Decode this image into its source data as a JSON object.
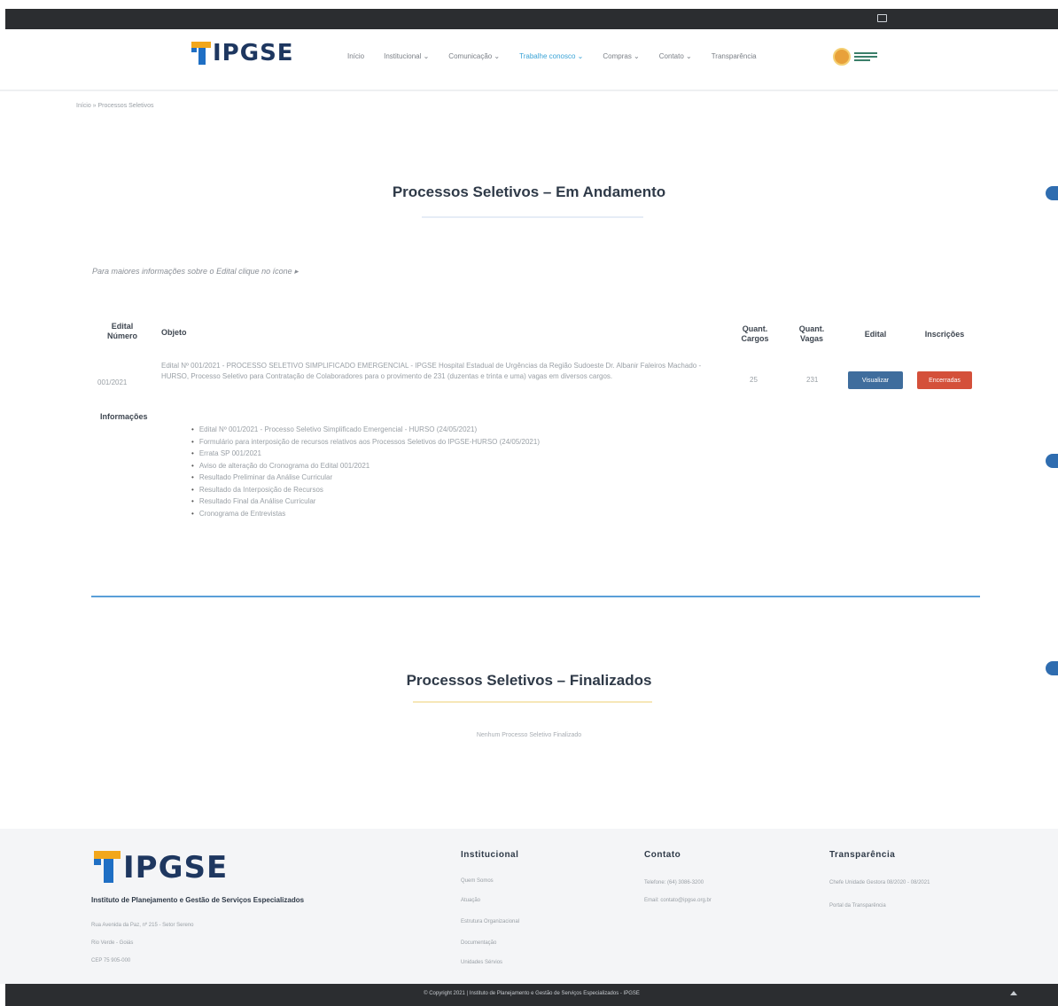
{
  "brand": {
    "name": "IPGSE",
    "tagline": "Instituto de Planejamento e Gestão de Serviços Especializados"
  },
  "nav": {
    "items": [
      "Início",
      "Institucional ⌄",
      "Comunicação ⌄",
      "Trabalhe conosco ⌄",
      "Compras ⌄",
      "Contato ⌄",
      "Transparência"
    ],
    "active_index": 3
  },
  "breadcrumb": "Início » Processos Seletivos",
  "andamento": {
    "title": "Processos Seletivos – Em Andamento",
    "info_line": "Para maiores informações sobre o Edital clique no ícone ▸",
    "table": {
      "headers": {
        "numero": "Edital Número",
        "objeto": "Objeto",
        "cargos": "Quant. Cargos",
        "vagas": "Quant. Vagas",
        "edital": "Edital",
        "inscricoes": "Inscrições"
      },
      "row": {
        "numero": "001/2021",
        "objeto": "Edital Nº 001/2021 - PROCESSO SELETIVO SIMPLIFICADO EMERGENCIAL - IPGSE Hospital Estadual de Urgências da Região Sudoeste Dr. Albanir Faleiros Machado - HURSO, Processo Seletivo para Contratação de Colaboradores para o provimento de 231 (duzentas e trinta e uma) vagas em diversos cargos.",
        "cargos": "25",
        "vagas": "231",
        "edital_button": "Visualizar",
        "inscricoes_button": "Encerradas"
      }
    },
    "info_label": "Informações",
    "info_items": [
      "Edital Nº 001/2021 - Processo Seletivo Simplificado Emergencial - HURSO (24/05/2021)",
      "Formulário para interposição de recursos relativos aos Processos Seletivos do IPGSE-HURSO (24/05/2021)",
      "Errata SP 001/2021",
      "Aviso de alteração do Cronograma do Edital 001/2021",
      "Resultado Preliminar da Análise Curricular",
      "Resultado da Interposição de Recursos",
      "Resultado Final da Análise Curricular",
      "Cronograma de Entrevistas"
    ]
  },
  "finalizados": {
    "title": "Processos Seletivos – Finalizados",
    "empty": "Nenhum Processo Seletivo Finalizado"
  },
  "footer": {
    "address": [
      "Rua Avenida da Paz, nº 215 - Setor Sereno",
      "Rio Verde - Goiás",
      "CEP 75 905-000"
    ],
    "institucional": {
      "heading": "Institucional",
      "links": [
        "Quem Somos",
        "Atuação",
        "Estrutura Organizacional",
        "Documentação",
        "Unidades Sérvios"
      ]
    },
    "contato": {
      "heading": "Contato",
      "lines": [
        "Telefone: (64) 3086-3200",
        "Email: contato@ipgse.org.br"
      ]
    },
    "transparencia": {
      "heading": "Transparência",
      "links": [
        "Chefe Unidade Gestora 08/2020 - 08/2021",
        "Portal da Transparência"
      ]
    }
  },
  "copyright": "© Copyright 2021 | Instituto de Planejamento e Gestão de Serviços Especializados - IPGSE",
  "colors": {
    "topbar": "#2b2d30",
    "nav_active": "#3aa3d6",
    "logo_orange": "#f2a71b",
    "logo_blue": "#1f6fc4",
    "button_blue": "#3f6d9d",
    "button_red": "#d4503a",
    "divider": "#5a9fd8"
  }
}
